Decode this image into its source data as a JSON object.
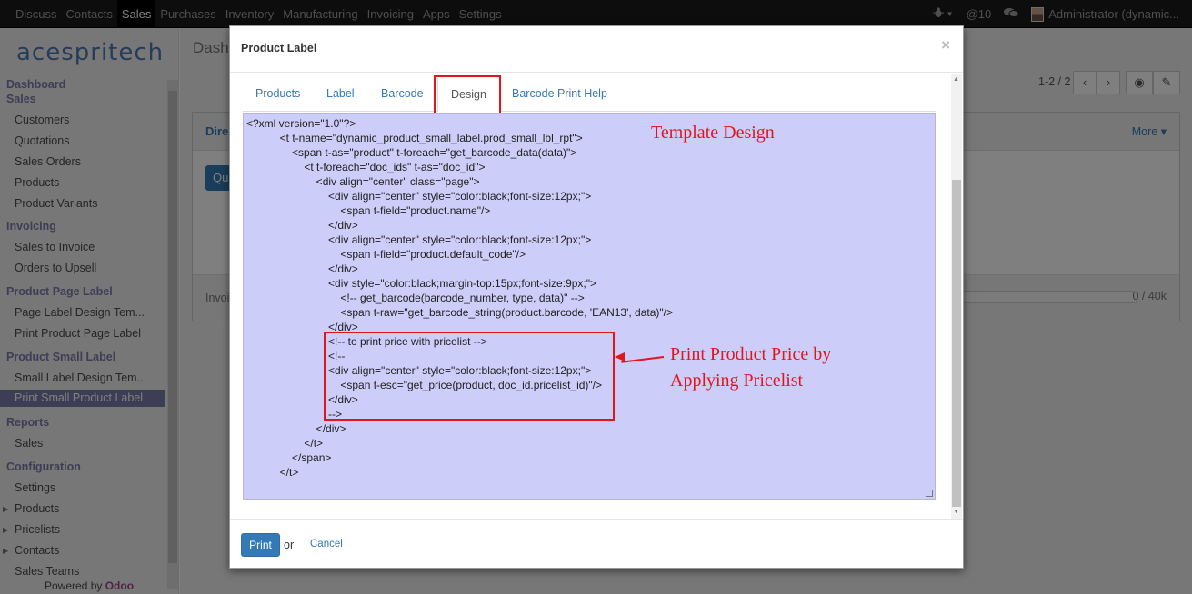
{
  "topbar": {
    "menu": [
      "Discuss",
      "Contacts",
      "Sales",
      "Purchases",
      "Inventory",
      "Manufacturing",
      "Invoicing",
      "Apps",
      "Settings"
    ],
    "active": "Sales",
    "bug_icon": "bug-icon",
    "mentions": "10",
    "user": "Administrator (dynamic..."
  },
  "sidebar": {
    "logo": "acespritech",
    "sections": [
      {
        "title": "Dashboard"
      },
      {
        "title": "Sales",
        "items": [
          "Customers",
          "Quotations",
          "Sales Orders",
          "Products",
          "Product Variants"
        ]
      },
      {
        "title": "Invoicing",
        "items": [
          "Sales to Invoice",
          "Orders to Upsell"
        ]
      },
      {
        "title": "Product Page Label",
        "items": [
          "Page Label Design Tem...",
          "Print Product Page Label"
        ]
      },
      {
        "title": "Product Small Label",
        "items": [
          "Small Label Design Tem..",
          "Print Small Product Label"
        ]
      },
      {
        "title": "Reports",
        "items": [
          "Sales"
        ]
      },
      {
        "title": "Configuration",
        "items": [
          "Settings",
          "Products",
          "Pricelists",
          "Contacts",
          "Sales Teams"
        ]
      }
    ],
    "selected": "Print Small Product Label",
    "powered_prefix": "Powered by",
    "powered_brand": "Odoo"
  },
  "main": {
    "title": "Dashb",
    "pager": "1-2 / 2",
    "card_head": "Direc",
    "more": "More",
    "quote_btn": "Qu",
    "invoice_label": "Invoi",
    "progress_value": "0 / 40k"
  },
  "modal": {
    "title": "Product Label",
    "close": "×",
    "tabs": [
      "Products",
      "Label",
      "Barcode",
      "Design",
      "Barcode Print Help"
    ],
    "active_tab": "Design",
    "code_lines": [
      "<?xml version=\"1.0\"?>",
      "           <t t-name=\"dynamic_product_small_label.prod_small_lbl_rpt\">",
      "               <span t-as=\"product\" t-foreach=\"get_barcode_data(data)\">",
      "                   <t t-foreach=\"doc_ids\" t-as=\"doc_id\">",
      "                       <div align=\"center\" class=\"page\">",
      "                           <div align=\"center\" style=\"color:black;font-size:12px;\">",
      "                               <span t-field=\"product.name\"/>",
      "                           </div>",
      "                           <div align=\"center\" style=\"color:black;font-size:12px;\">",
      "                               <span t-field=\"product.default_code\"/>",
      "                           </div>",
      "                           <div style=\"color:black;margin-top:15px;font-size:9px;\">",
      "                               <!-- get_barcode(barcode_number, type, data)\" -->",
      "                               <span t-raw=\"get_barcode_string(product.barcode, 'EAN13', data)\"/>",
      "                           </div>",
      "                           <!-- to print price with pricelist -->",
      "                           <!--",
      "                           <div align=\"center\" style=\"color:black;font-size:12px;\">",
      "                               <span t-esc=\"get_price(product, doc_id.pricelist_id)\"/>",
      "                           </div>",
      "                           -->",
      "                       </div>",
      "                   </t>",
      "               </span>",
      "           </t>"
    ],
    "annotation_template": "Template Design",
    "annotation_price_1": "Print Product Price by",
    "annotation_price_2": "Applying Pricelist",
    "print_label": "Print",
    "or_label": "or",
    "cancel_label": "Cancel"
  }
}
